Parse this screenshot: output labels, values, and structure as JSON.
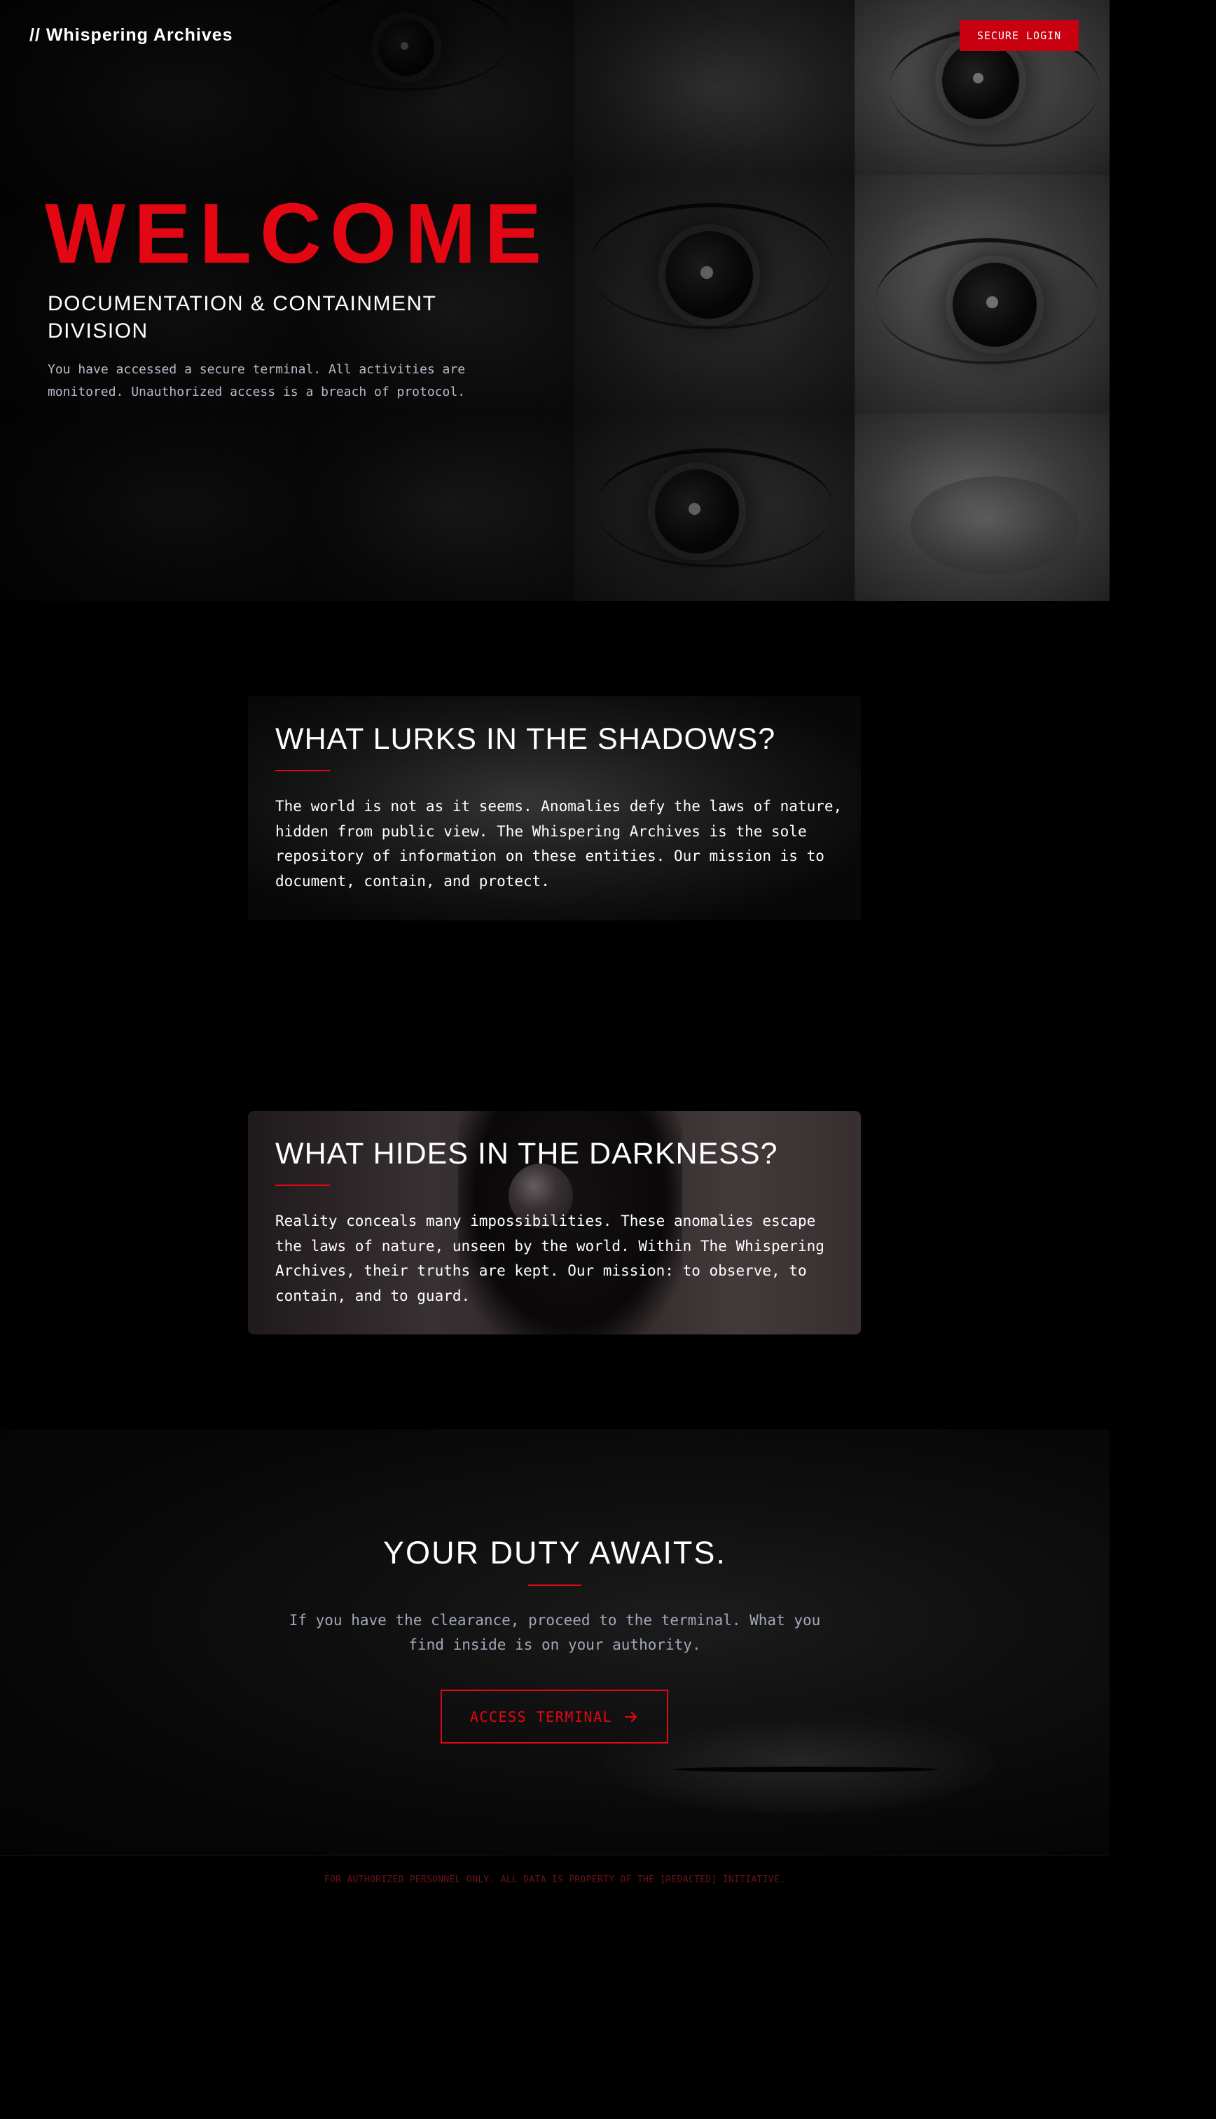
{
  "header": {
    "brand": "// Whispering Archives",
    "login_label": "SECURE LOGIN"
  },
  "hero": {
    "title": "WELCOME",
    "subtitle": "DOCUMENTATION & CONTAINMENT DIVISION",
    "text": "You have accessed a secure terminal. All activities are monitored. Unauthorized access is a breach of protocol."
  },
  "sections": [
    {
      "title": "WHAT LURKS IN THE SHADOWS?",
      "body": "The world is not as it seems. Anomalies defy the laws of nature, hidden from public view. The Whispering Archives is the sole repository of information on these entities. Our mission is to document, contain, and protect."
    },
    {
      "title": "WHAT HIDES IN THE DARKNESS?",
      "body": "Reality conceals many impossibilities. These anomalies escape the laws of nature, unseen by the world. Within The Whispering Archives, their truths are kept. Our mission: to observe, to contain, and to guard."
    }
  ],
  "cta": {
    "title": "YOUR DUTY AWAITS.",
    "text": "If you have the clearance, proceed to the terminal. What you find inside is on your authority.",
    "button_label": "ACCESS TERMINAL"
  },
  "footer": {
    "text": "FOR AUTHORIZED PERSONNEL ONLY. ALL DATA IS PROPERTY OF THE [REDACTED] INITIATIVE."
  },
  "colors": {
    "accent": "#e30613",
    "button_bg": "#c8000f",
    "background": "#000000",
    "muted_text": "#a2a8bc",
    "footer_text": "#6b1317"
  },
  "icons": {
    "cta_button": "arrow-right-icon"
  }
}
